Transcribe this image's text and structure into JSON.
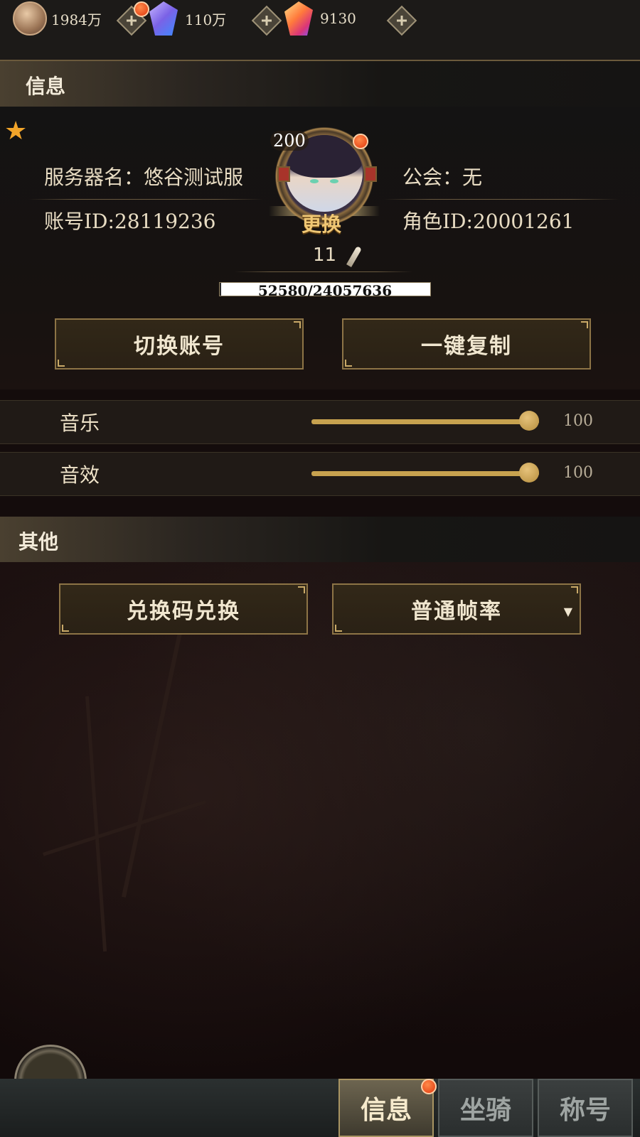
{
  "resources": [
    {
      "icon": "copper-coin-icon",
      "value": "1984万"
    },
    {
      "icon": "blue-crystal-icon",
      "value": "110万"
    },
    {
      "icon": "rainbow-crystal-icon",
      "value": "9130"
    }
  ],
  "info_section": {
    "title": "信息",
    "server": "服务器名：悠谷测试服",
    "guild": "公会：无",
    "account_id": "账号ID:28119236",
    "role_id": "角色ID:20001261",
    "avatar": {
      "level": "200",
      "change_label": "更换"
    },
    "vip_level": "11",
    "exp": {
      "text": "52580/24057636",
      "progress": 0.0022
    },
    "buttons": {
      "switch_account": "切换账号",
      "copy": "一键复制"
    }
  },
  "sound": {
    "music": {
      "label": "音乐",
      "value": "100",
      "level": 1.0
    },
    "effects": {
      "label": "音效",
      "value": "100",
      "level": 1.0
    }
  },
  "other_section": {
    "title": "其他",
    "redeem_button": "兑换码兑换",
    "framerate_select": "普通帧率"
  },
  "bottom_tabs": [
    {
      "label": "信息",
      "active": true
    },
    {
      "label": "坐骑",
      "active": false
    },
    {
      "label": "称号",
      "active": false
    }
  ],
  "colors": {
    "accent_gold": "#c7a24f",
    "notification_red": "#e0380e"
  }
}
